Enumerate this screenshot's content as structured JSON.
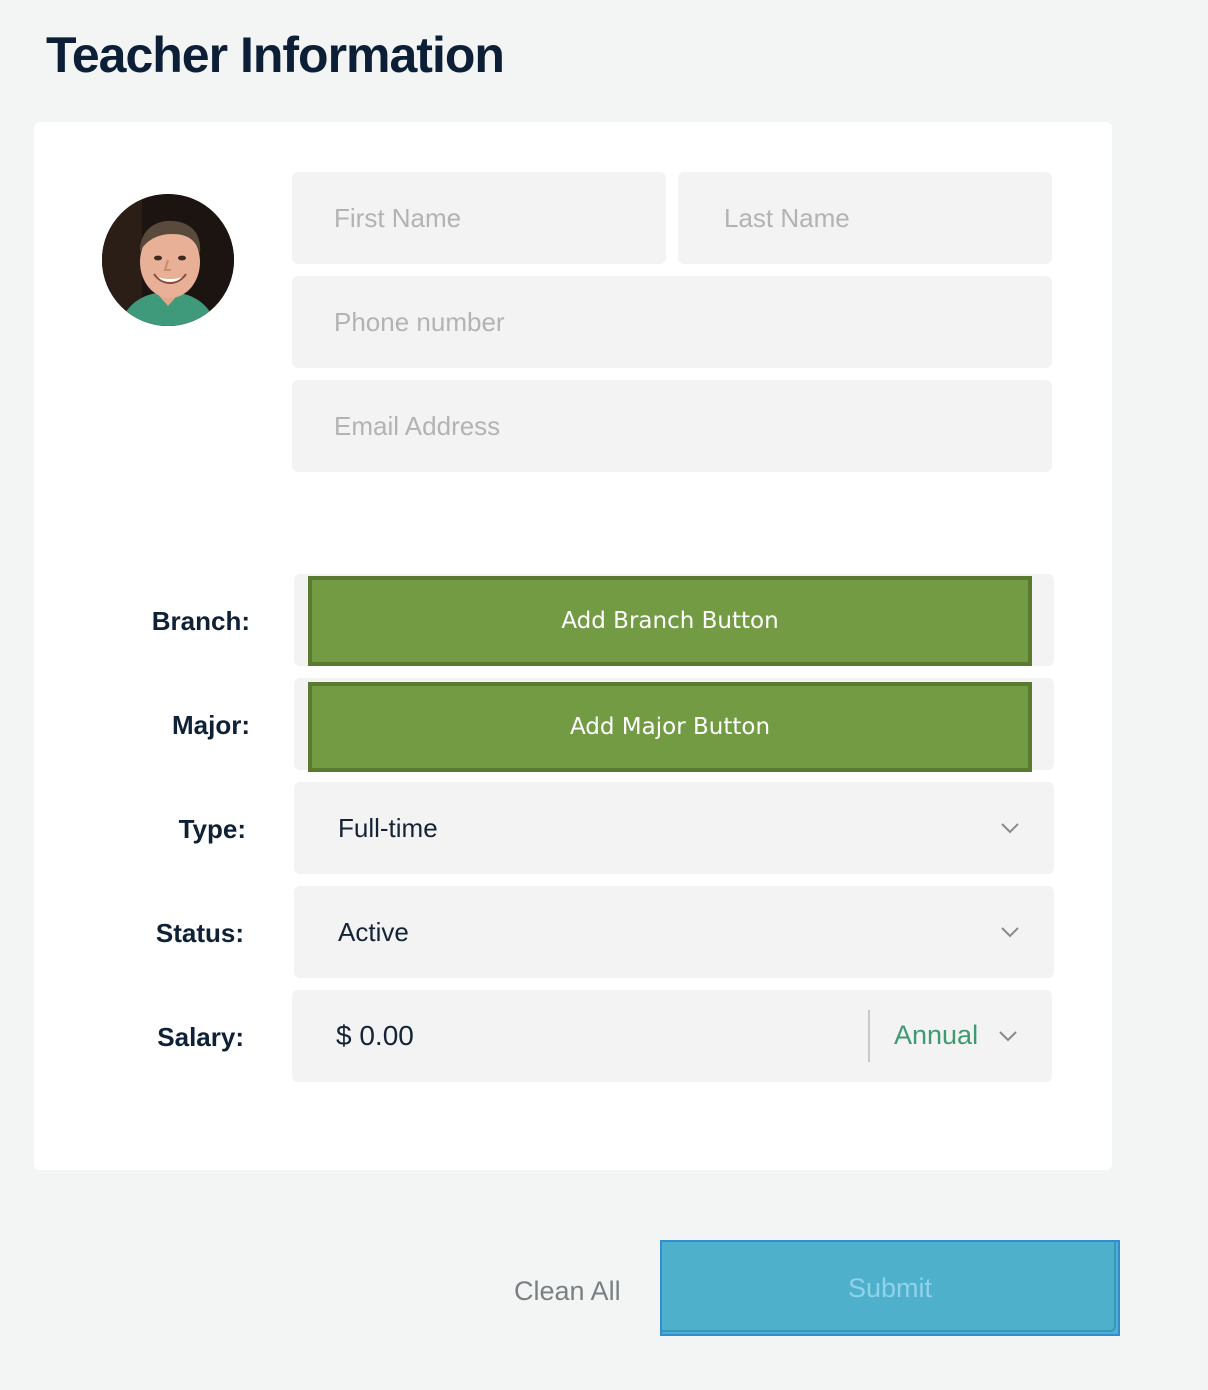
{
  "page": {
    "title": "Teacher Information"
  },
  "form": {
    "first_name": {
      "placeholder": "First Name",
      "value": ""
    },
    "last_name": {
      "placeholder": "Last Name",
      "value": ""
    },
    "phone": {
      "placeholder": "Phone number",
      "value": ""
    },
    "email": {
      "placeholder": "Email Address",
      "value": ""
    }
  },
  "rows": {
    "branch": {
      "label": "Branch:",
      "button": "Add Branch Button"
    },
    "major": {
      "label": "Major:",
      "button": "Add Major Button"
    },
    "type": {
      "label": "Type:",
      "value": "Full-time",
      "icon": "chevron-down-icon"
    },
    "status": {
      "label": "Status:",
      "value": "Active",
      "icon": "chevron-down-icon"
    },
    "salary": {
      "label": "Salary:",
      "amount": "$ 0.00",
      "period": "Annual",
      "icon": "chevron-down-icon"
    }
  },
  "actions": {
    "clean_all": "Clean All",
    "submit": "Submit"
  },
  "colors": {
    "green_button": "#739b44",
    "submit_button": "#4fb0cb",
    "accent_text": "#3f9a72",
    "title": "#0c1f36"
  },
  "avatar": {
    "icon": "teacher-avatar"
  }
}
